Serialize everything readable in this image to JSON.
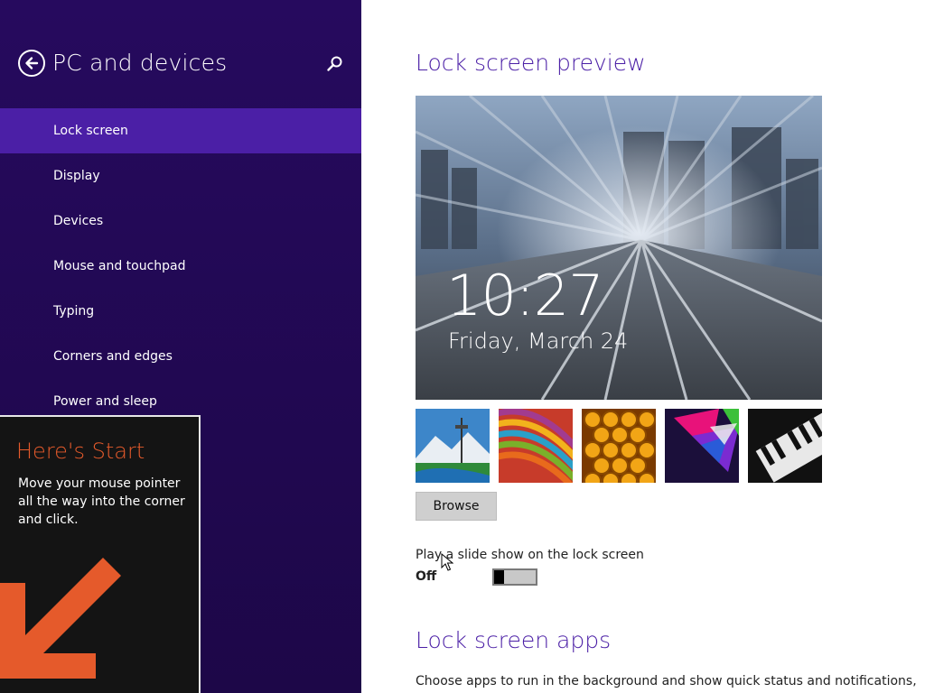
{
  "sidebar": {
    "title": "PC and devices",
    "items": [
      {
        "label": "Lock screen",
        "selected": true
      },
      {
        "label": "Display"
      },
      {
        "label": "Devices"
      },
      {
        "label": "Mouse and touchpad"
      },
      {
        "label": "Typing"
      },
      {
        "label": "Corners and edges"
      },
      {
        "label": "Power and sleep"
      }
    ],
    "icons": {
      "back": "back-arrow-icon",
      "search": "search-icon"
    }
  },
  "start_tip": {
    "title": "Here's Start",
    "body": "Move your mouse pointer all the way into the corner and click."
  },
  "main": {
    "preview_heading": "Lock screen preview",
    "preview": {
      "time": "10:27",
      "date": "Friday, March 24"
    },
    "thumbnails": [
      "space-needle-mountain",
      "color-stripes",
      "honeycomb",
      "geometric-shapes",
      "piano-keys"
    ],
    "browse_label": "Browse",
    "slideshow_label": "Play a slide show on the lock screen",
    "slideshow_state": "Off",
    "apps_heading": "Lock screen apps",
    "apps_description": "Choose apps to run in the background and show quick status and notifications,"
  },
  "colors": {
    "sidebar_bg": "#260a5e",
    "selected_bg": "#4b1fa6",
    "accent": "#4b1fa6",
    "tip_title": "#e55a2b"
  }
}
